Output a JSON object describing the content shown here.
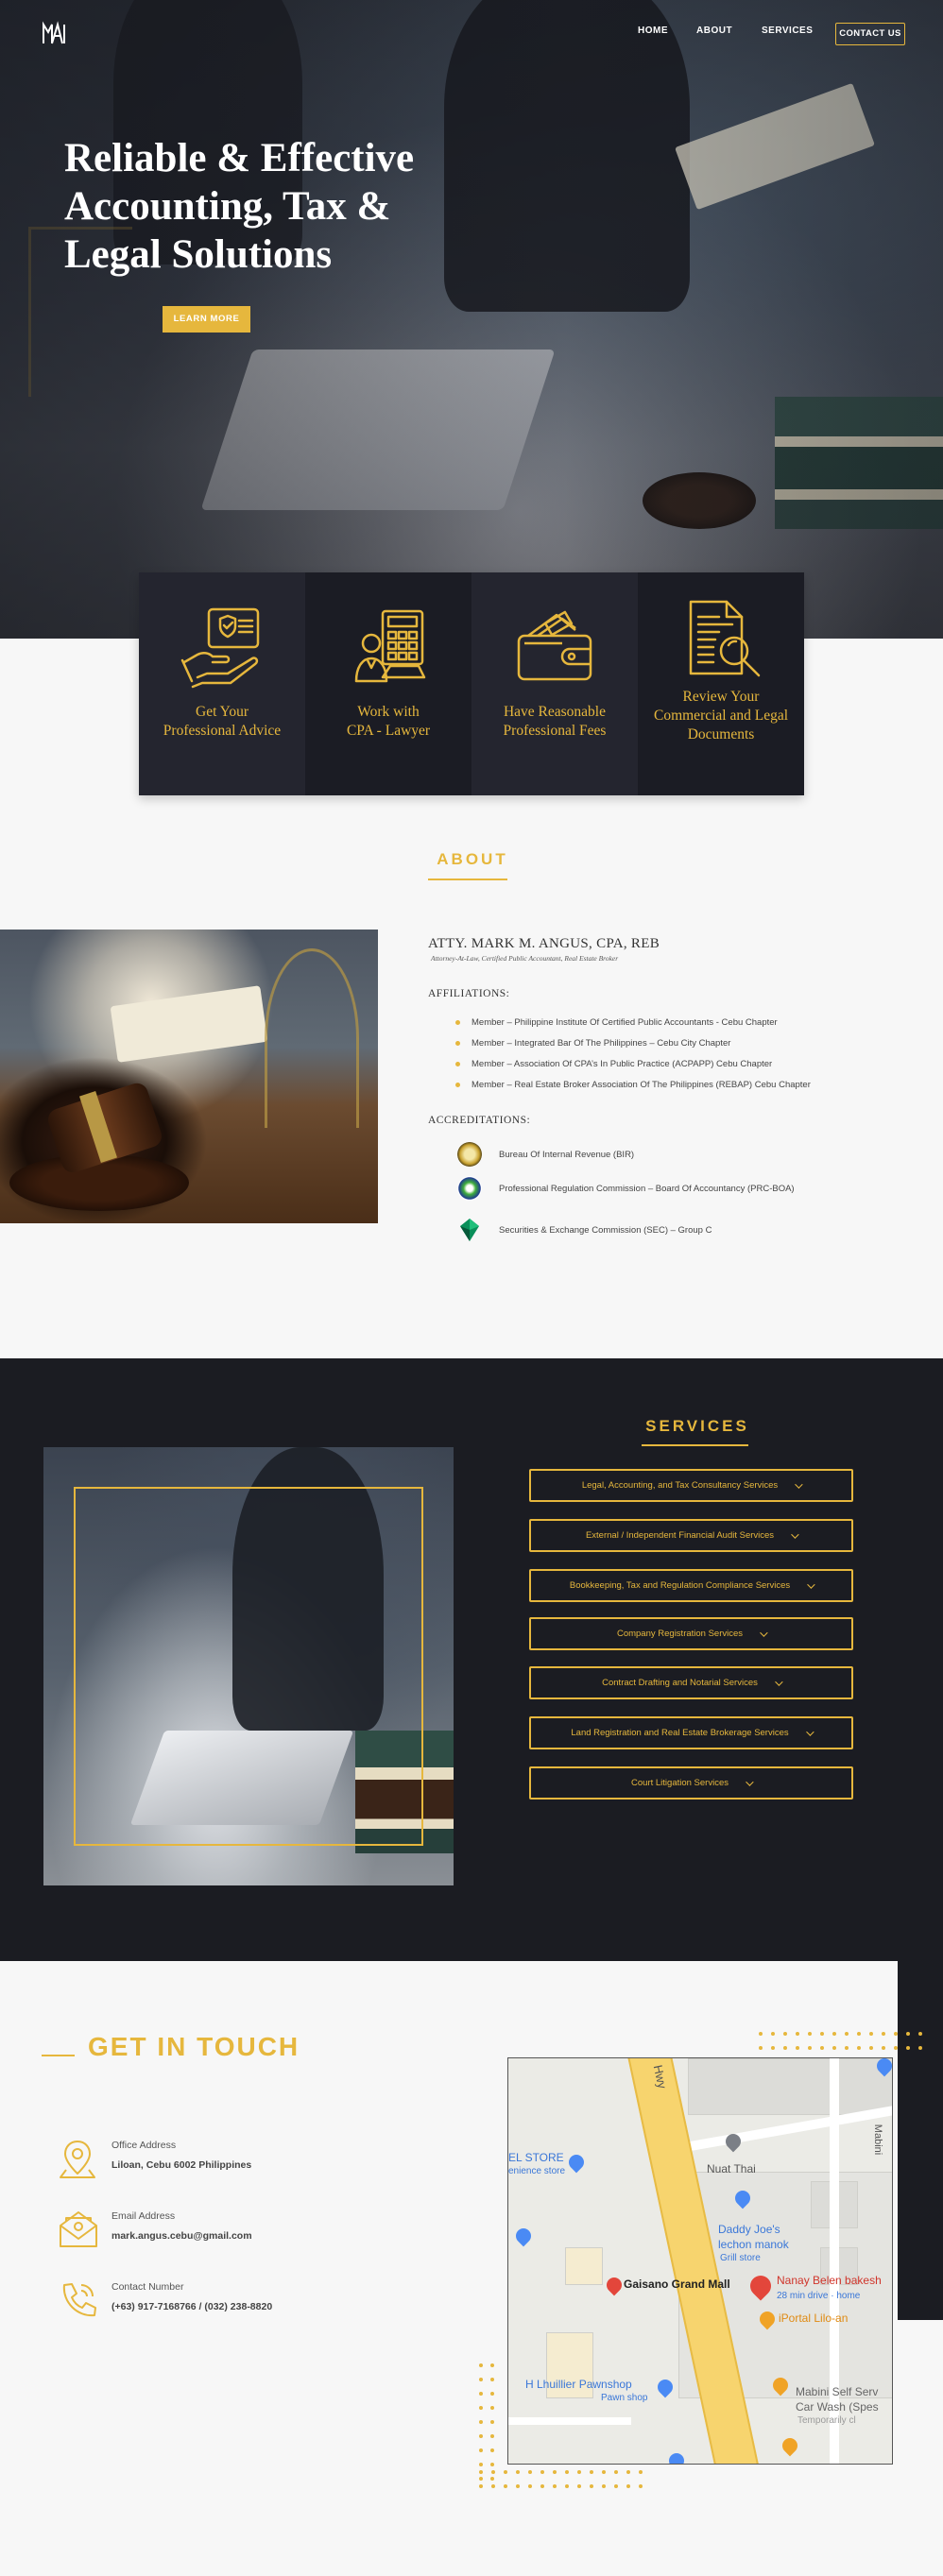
{
  "colors": {
    "accent": "#e6b73d",
    "dark": "#1b1c22",
    "card": "#24252f",
    "light_bg": "#f7f7f7"
  },
  "header": {
    "logo_text": "MA",
    "nav": [
      "HOME",
      "ABOUT",
      "SERVICES"
    ],
    "contact_label": "CONTACT US"
  },
  "hero": {
    "title": "Reliable & Effective Accounting, Tax & Legal Solutions",
    "cta": "LEARN MORE"
  },
  "features": [
    {
      "icon": "advice-hand-icon",
      "text": "Get Your\nProfessional Advice"
    },
    {
      "icon": "calculator-lawyer-icon",
      "text": "Work with\nCPA - Lawyer"
    },
    {
      "icon": "wallet-icon",
      "text": "Have Reasonable\nProfessional Fees"
    },
    {
      "icon": "document-review-icon",
      "text": "Review Your\nCommercial and Legal\nDocuments"
    }
  ],
  "about": {
    "title": "ABOUT",
    "name": "ATTY. MARK M. ANGUS, CPA, REB",
    "subtitle": "Attorney-At-Law, Certified Public Accountant, Real Estate Broker",
    "affiliations_title": "AFFILIATIONS:",
    "affiliations": [
      "Member – Philippine Institute Of Certified Public Accountants - Cebu Chapter",
      "Member – Integrated Bar Of The Philippines – Cebu City Chapter",
      "Member – Association Of CPA’s In Public Practice (ACPAPP) Cebu Chapter",
      "Member – Real Estate Broker Association Of The Philippines (REBAP) Cebu Chapter"
    ],
    "accreditations_title": "ACCREDITATIONS:",
    "accreditations": [
      {
        "icon": "bir-seal-icon",
        "text": "Bureau Of Internal Revenue (BIR)"
      },
      {
        "icon": "prc-seal-icon",
        "text": "Professional Regulation Commission – Board Of Accountancy (PRC-BOA)"
      },
      {
        "icon": "sec-logo-icon",
        "text": "Securities & Exchange Commission (SEC) – Group C"
      }
    ]
  },
  "services": {
    "title": "SERVICES",
    "items": [
      "Legal, Accounting, and Tax Consultancy Services",
      "External / Independent Financial Audit Services",
      "Bookkeeping, Tax and Regulation Compliance Services",
      "Company Registration Services",
      "Contract Drafting and Notarial Services",
      "Land Registration and Real Estate Brokerage Services",
      "Court Litigation Services"
    ]
  },
  "contact": {
    "title": "GET IN TOUCH",
    "items": [
      {
        "icon": "location-pin-icon",
        "label": "Office Address",
        "value": "Liloan, Cebu 6002 Philippines"
      },
      {
        "icon": "email-icon",
        "label": "Email Address",
        "value": " mark.angus.cebu@gmail.com"
      },
      {
        "icon": "phone-icon",
        "label": "Contact Number",
        "value": "(+63) 917-7168766 /  (032) 238-8820"
      }
    ]
  },
  "map": {
    "labels": {
      "hwy": "Hwy",
      "store": "EL STORE",
      "store_sub": "enience store",
      "nuat": "Nuat Thai",
      "daddy": "Daddy Joe's",
      "daddy2": "lechon manok",
      "daddy_sub": "Grill store",
      "gaisano": "Gaisano Grand Mall",
      "nanay": "Nanay Belen bakesh",
      "nanay_sub": "28 min drive · home",
      "iportal": "iPortal Lilo-an",
      "lhuillier": "H Lhuillier Pawnshop",
      "lhuillier_sub": "Pawn shop",
      "mabini_road": "Mabini",
      "mabini": "Mabini Self Serv",
      "mabini2": "Car Wash (Spes",
      "mabini_sub": "Temporarily cl"
    }
  }
}
